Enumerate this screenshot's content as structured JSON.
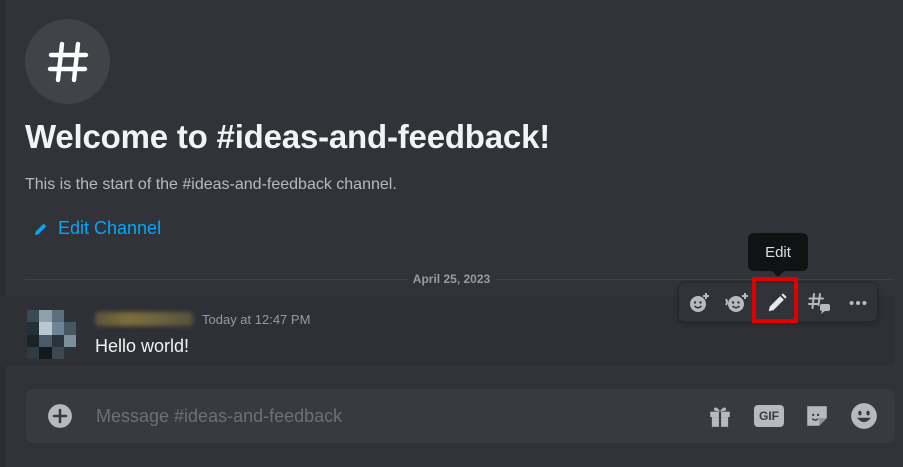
{
  "channel": {
    "icon": "hashtag-icon",
    "welcome_title": "Welcome to #ideas-and-feedback!",
    "welcome_subtitle": "This is the start of the #ideas-and-feedback channel.",
    "edit_channel_label": "Edit Channel",
    "edit_channel_icon": "pencil-icon"
  },
  "date_divider": "April 25, 2023",
  "message": {
    "timestamp": "Today at 12:47 PM",
    "text": "Hello world!"
  },
  "toolbar": {
    "tooltip": "Edit",
    "buttons": [
      "add-reaction-icon",
      "super-reaction-icon",
      "edit-pencil-icon",
      "create-thread-icon",
      "more-options-icon"
    ]
  },
  "composer": {
    "placeholder": "Message #ideas-and-feedback",
    "gif_label": "GIF",
    "icons": [
      "add-circle-icon",
      "gift-icon",
      "gif-icon",
      "sticker-icon",
      "emoji-icon"
    ]
  },
  "colors": {
    "background": "#313338",
    "link": "#00a8fc",
    "highlight": "#e00000"
  }
}
